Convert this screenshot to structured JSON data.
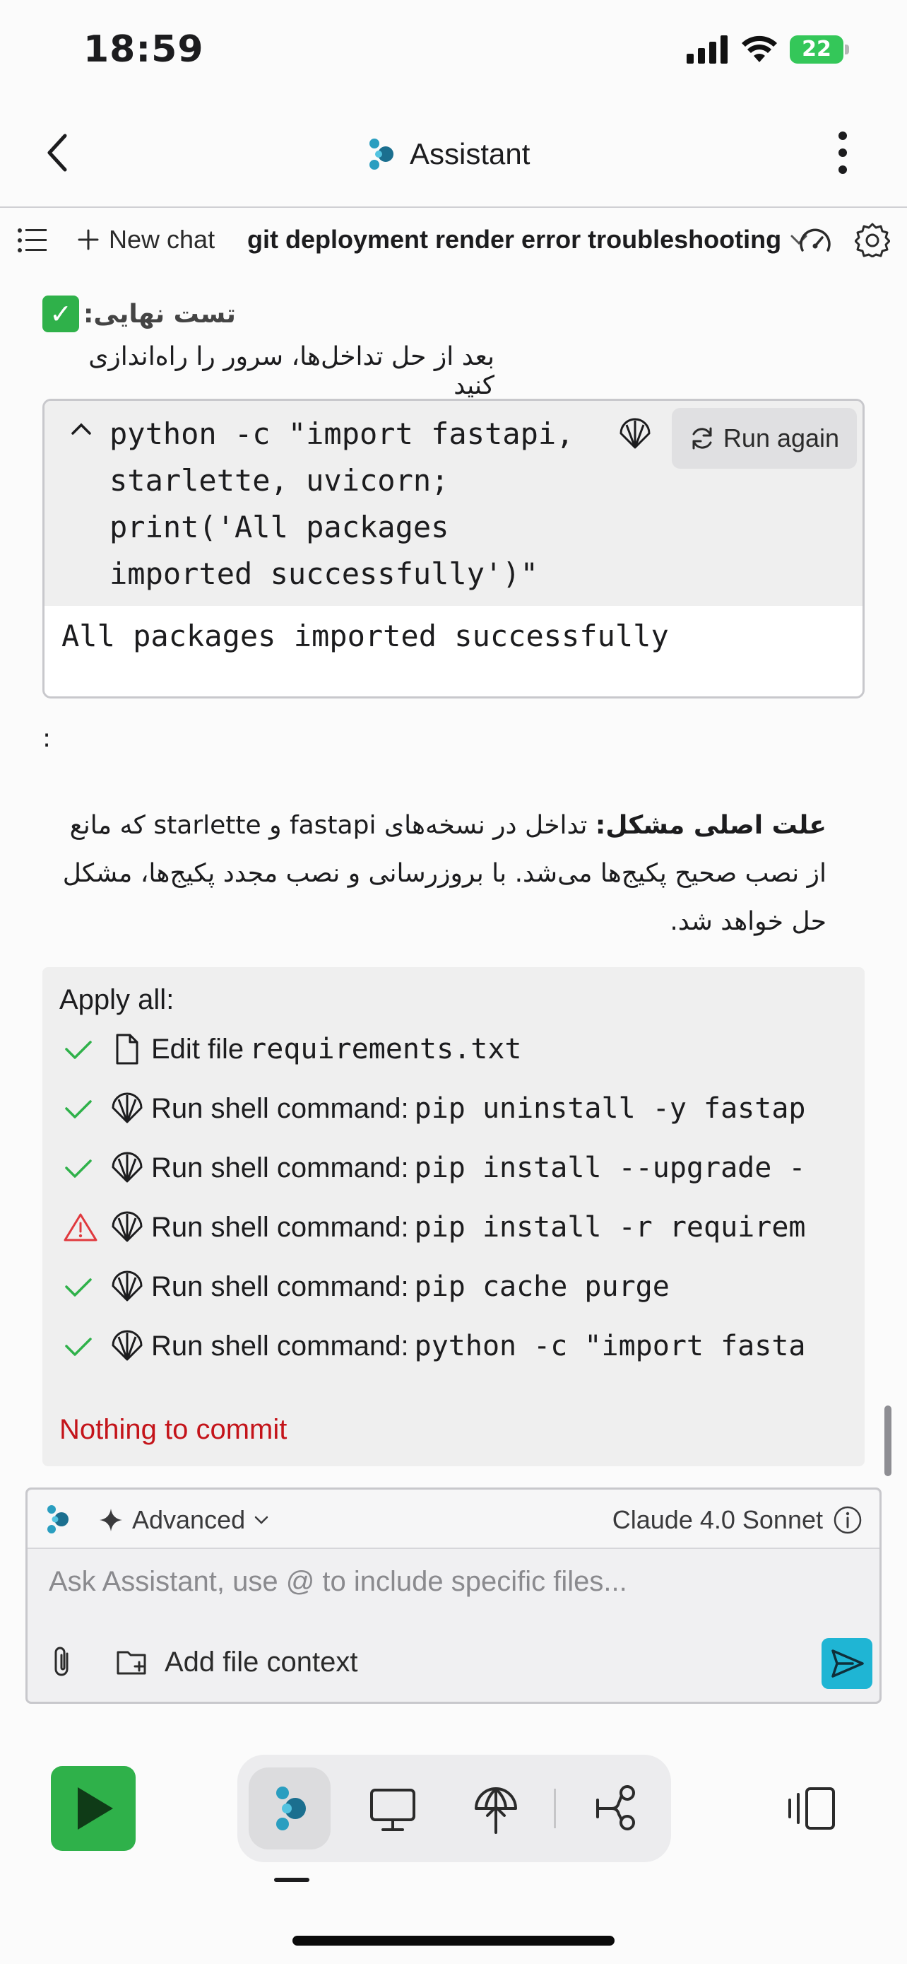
{
  "status_bar": {
    "time": "18:59",
    "battery": "22"
  },
  "header": {
    "title": "Assistant"
  },
  "toolbar": {
    "new_chat": "New chat",
    "chat_title": "git deployment render error troubleshooting"
  },
  "content": {
    "final_test_heading": "تست نهایی:",
    "final_test_sub": "بعد از حل تداخل‌ها، سرور را راه‌اندازی کنید",
    "code": {
      "command": "python -c \"import fastapi,\nstarlette, uvicorn;\nprint('All packages\nimported successfully')\"",
      "run_again": "Run again",
      "output": "All packages imported successfully"
    },
    "colon": ":",
    "root_cause_label": "علت اصلی مشکل:",
    "root_cause_text": " تداخل در نسخه‌های fastapi و starlette که مانع از نصب صحیح پکیج‌ها می‌شد. با بروزرسانی و نصب مجدد پکیج‌ها، مشکل حل خواهد شد."
  },
  "apply": {
    "title": "Apply all:",
    "rows": [
      {
        "status": "done",
        "kind": "file",
        "label": "Edit file",
        "cmd": "requirements.txt"
      },
      {
        "status": "done",
        "kind": "shell",
        "label": "Run shell command:",
        "cmd": "pip uninstall -y fastap"
      },
      {
        "status": "done",
        "kind": "shell",
        "label": "Run shell command:",
        "cmd": "pip install --upgrade -"
      },
      {
        "status": "warning",
        "kind": "shell",
        "label": "Run shell command:",
        "cmd": "pip install -r requirem"
      },
      {
        "status": "done",
        "kind": "shell",
        "label": "Run shell command:",
        "cmd": "pip cache purge"
      },
      {
        "status": "done",
        "kind": "shell",
        "label": "Run shell command:",
        "cmd": "python -c \"import fasta"
      }
    ],
    "nothing_to_commit": "Nothing to commit"
  },
  "input": {
    "mode": "Advanced",
    "model": "Claude 4.0 Sonnet",
    "placeholder": "Ask Assistant, use @ to include specific files...",
    "add_context": "Add file context"
  },
  "colors": {
    "accent_green": "#2fb14a",
    "send_blue": "#1fb5d4",
    "error_red": "#c4141a",
    "warning_red": "#e0393e"
  },
  "icons": [
    "signal-icon",
    "wifi-icon",
    "battery-icon",
    "back-icon",
    "assistant-logo-icon",
    "more-icon",
    "list-icon",
    "plus-icon",
    "chevron-down-icon",
    "gauge-icon",
    "gear-icon",
    "caret-up-icon",
    "shell-icon",
    "refresh-icon",
    "check-icon",
    "warning-icon",
    "file-icon",
    "sparkle-icon",
    "info-icon",
    "paperclip-icon",
    "folder-plus-icon",
    "send-icon",
    "play-icon",
    "desktop-icon",
    "deploy-icon",
    "git-icon",
    "split-view-icon"
  ]
}
